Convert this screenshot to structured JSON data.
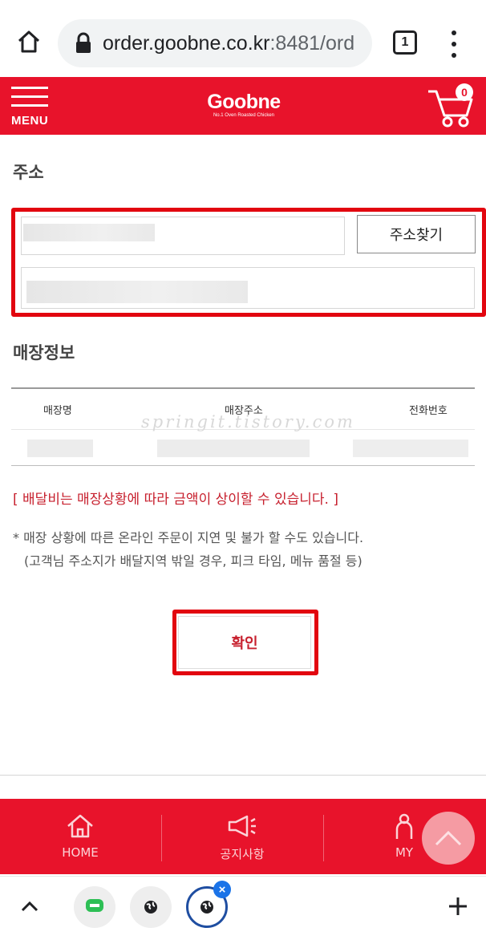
{
  "browser": {
    "url_host": "order.goobne.co.kr",
    "url_rest": ":8481/ord",
    "tab_count": "1"
  },
  "header": {
    "menu_label": "MENU",
    "logo_text": "Goobne",
    "logo_tagline": "No.1 Oven Roasted Chicken",
    "cart_count": "0"
  },
  "address": {
    "title": "주소",
    "find_button": "주소찾기"
  },
  "store": {
    "title": "매장정보",
    "columns": [
      "매장명",
      "매장주소",
      "전화번호"
    ]
  },
  "watermark": "springit.tistory.com",
  "notice": "[ 배달비는 매장상황에 따라 금액이 상이할 수 있습니다. ]",
  "notes": [
    "* 매장 상황에 따른 온라인 주문이 지연 및 불가 할 수도 있습니다.",
    "(고객님 주소지가 배달지역 밖일 경우, 피크 타임, 메뉴 품절 등)"
  ],
  "confirm_label": "확인",
  "bottom_nav": [
    {
      "label": "HOME",
      "icon": "home-icon"
    },
    {
      "label": "공지사항",
      "icon": "megaphone-icon"
    },
    {
      "label": "MY",
      "icon": "person-icon"
    }
  ],
  "colors": {
    "brand_red": "#e8132b",
    "highlight_red": "#e2060f",
    "notice_red": "#c7202e",
    "active_tab_ring": "#1f4ea1"
  }
}
